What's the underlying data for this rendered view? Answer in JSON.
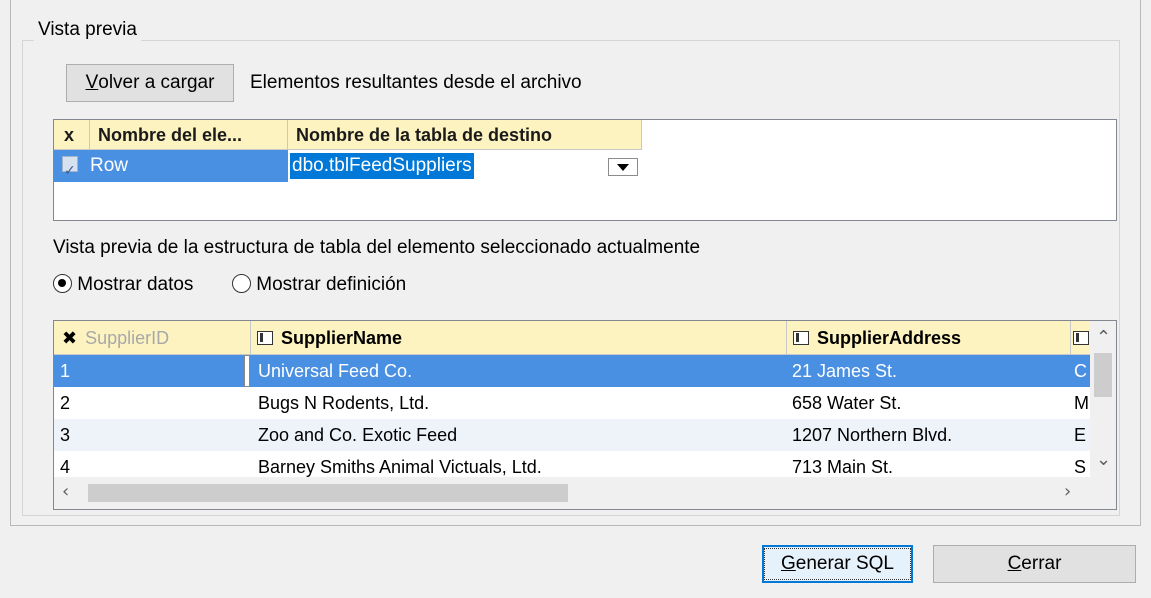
{
  "group": {
    "title": "Vista previa"
  },
  "reload": {
    "label_underlined": "V",
    "label_rest": "olver a cargar"
  },
  "source_label": "Elementos resultantes desde el archivo",
  "elements_grid": {
    "headers": {
      "check": "x",
      "element_name": "Nombre del ele...",
      "target_table": "Nombre de la tabla de destino"
    },
    "rows": [
      {
        "checked": true,
        "element": "Row",
        "target": "dbo.tblFeedSuppliers"
      }
    ]
  },
  "preview_label": "Vista previa de la estructura de tabla del elemento seleccionado actualmente",
  "radios": {
    "show_data": {
      "label": "Mostrar datos",
      "selected": true
    },
    "show_definition": {
      "label": "Mostrar definición",
      "selected": false
    }
  },
  "data_grid": {
    "columns": [
      "SupplierID",
      "SupplierName",
      "SupplierAddress"
    ],
    "rows": [
      {
        "id": "1",
        "name": "Universal Feed Co.",
        "address": "21 James St.",
        "next": "C"
      },
      {
        "id": "2",
        "name": "Bugs N Rodents, Ltd.",
        "address": "658 Water St.",
        "next": "M"
      },
      {
        "id": "3",
        "name": "Zoo and Co. Exotic Feed",
        "address": "1207 Northern Blvd.",
        "next": "E"
      },
      {
        "id": "4",
        "name": "Barney Smiths Animal Victuals, Ltd.",
        "address": "713 Main St.",
        "next": "S"
      }
    ]
  },
  "buttons": {
    "generate_u": "G",
    "generate_rest": "enerar SQL",
    "close_u": "C",
    "close_rest": "errar"
  },
  "icons": {
    "check": "checkbox-checked-icon",
    "dropdown": "chevron-down-icon",
    "key_col": "cross-icon",
    "column": "column-icon"
  }
}
